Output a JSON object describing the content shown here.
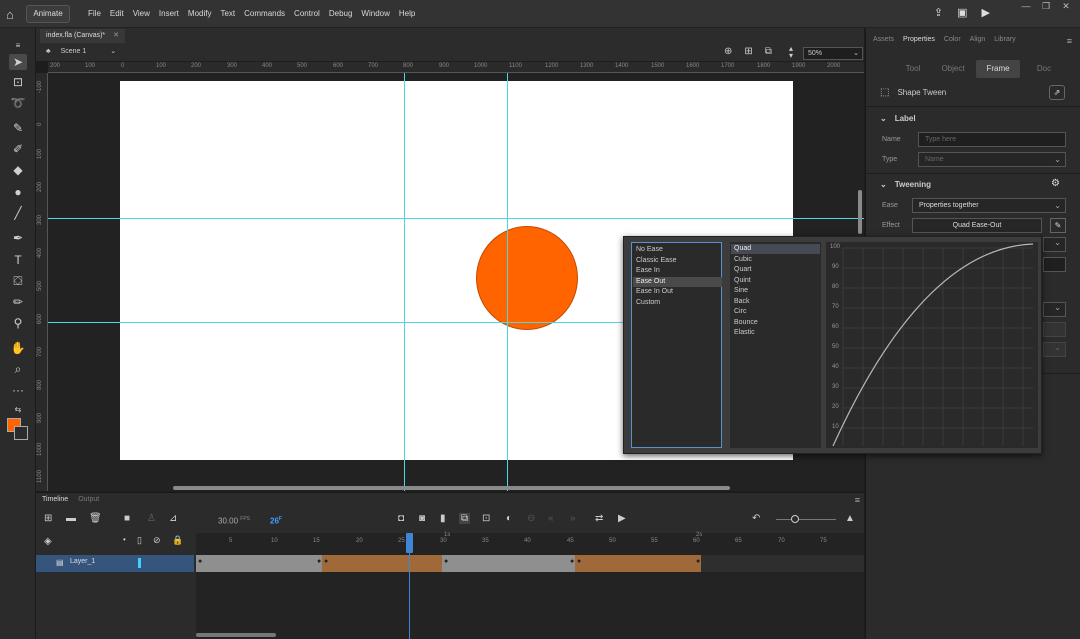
{
  "app": {
    "workspace_label": "Animate",
    "menus": [
      "File",
      "Edit",
      "View",
      "Insert",
      "Modify",
      "Text",
      "Commands",
      "Control",
      "Debug",
      "Window",
      "Help"
    ]
  },
  "document": {
    "tab_title": "index.fla (Canvas)*",
    "scene_label": "Scene 1",
    "zoom_value": "50%"
  },
  "rulers": {
    "top_ticks": [
      "200",
      "100",
      "0",
      "100",
      "200",
      "300",
      "400",
      "500",
      "600",
      "700",
      "800",
      "900",
      "1000",
      "1100",
      "1200",
      "1300",
      "1400",
      "1500",
      "1600",
      "1700",
      "1800",
      "1900",
      "2000"
    ],
    "left_ticks": [
      "-100",
      "0",
      "100",
      "200",
      "300",
      "400",
      "500",
      "600",
      "700",
      "800",
      "900",
      "1000",
      "1100"
    ]
  },
  "stage": {
    "ball_color": "#ff6400",
    "guide_color": "#4fd8e0"
  },
  "properties": {
    "panel_tabs": [
      "Assets",
      "Properties",
      "Color",
      "Align",
      "Library"
    ],
    "active_panel_tab": "Properties",
    "sub_tabs": [
      "Tool",
      "Object",
      "Frame",
      "Doc"
    ],
    "active_sub_tab": "Frame",
    "tween_type": "Shape Tween",
    "label_section": "Label",
    "name_label": "Name",
    "name_placeholder": "Type here",
    "type_label": "Type",
    "type_value": "Name",
    "tweening_section": "Tweening",
    "ease_label": "Ease",
    "ease_value": "Properties together",
    "effect_label": "Effect",
    "effect_value": "Quad Ease-Out"
  },
  "ease_popup": {
    "categories": [
      "No Ease",
      "Classic Ease",
      "Ease In",
      "Ease Out",
      "Ease In Out",
      "Custom"
    ],
    "selected_category": "Ease Out",
    "types": [
      "Quad",
      "Cubic",
      "Quart",
      "Quint",
      "Sine",
      "Back",
      "Circ",
      "Bounce",
      "Elastic"
    ],
    "selected_type": "Quad",
    "graph_y_labels": [
      "100",
      "90",
      "80",
      "70",
      "60",
      "50",
      "40",
      "30",
      "20",
      "10"
    ],
    "curve": "quad-ease-out"
  },
  "timeline": {
    "tabs": [
      "Timeline",
      "Output"
    ],
    "active_tab": "Timeline",
    "fps": "30.00",
    "fps_unit": "FPS",
    "current_frame": "26",
    "frame_unit": "F",
    "layer_name": "Layer_1",
    "frame_ticks": [
      "5",
      "10",
      "15",
      "20",
      "25",
      "30",
      "35",
      "40",
      "45",
      "50",
      "55",
      "60",
      "65",
      "70",
      "75"
    ],
    "second_marks": [
      "1s",
      "2s"
    ]
  }
}
